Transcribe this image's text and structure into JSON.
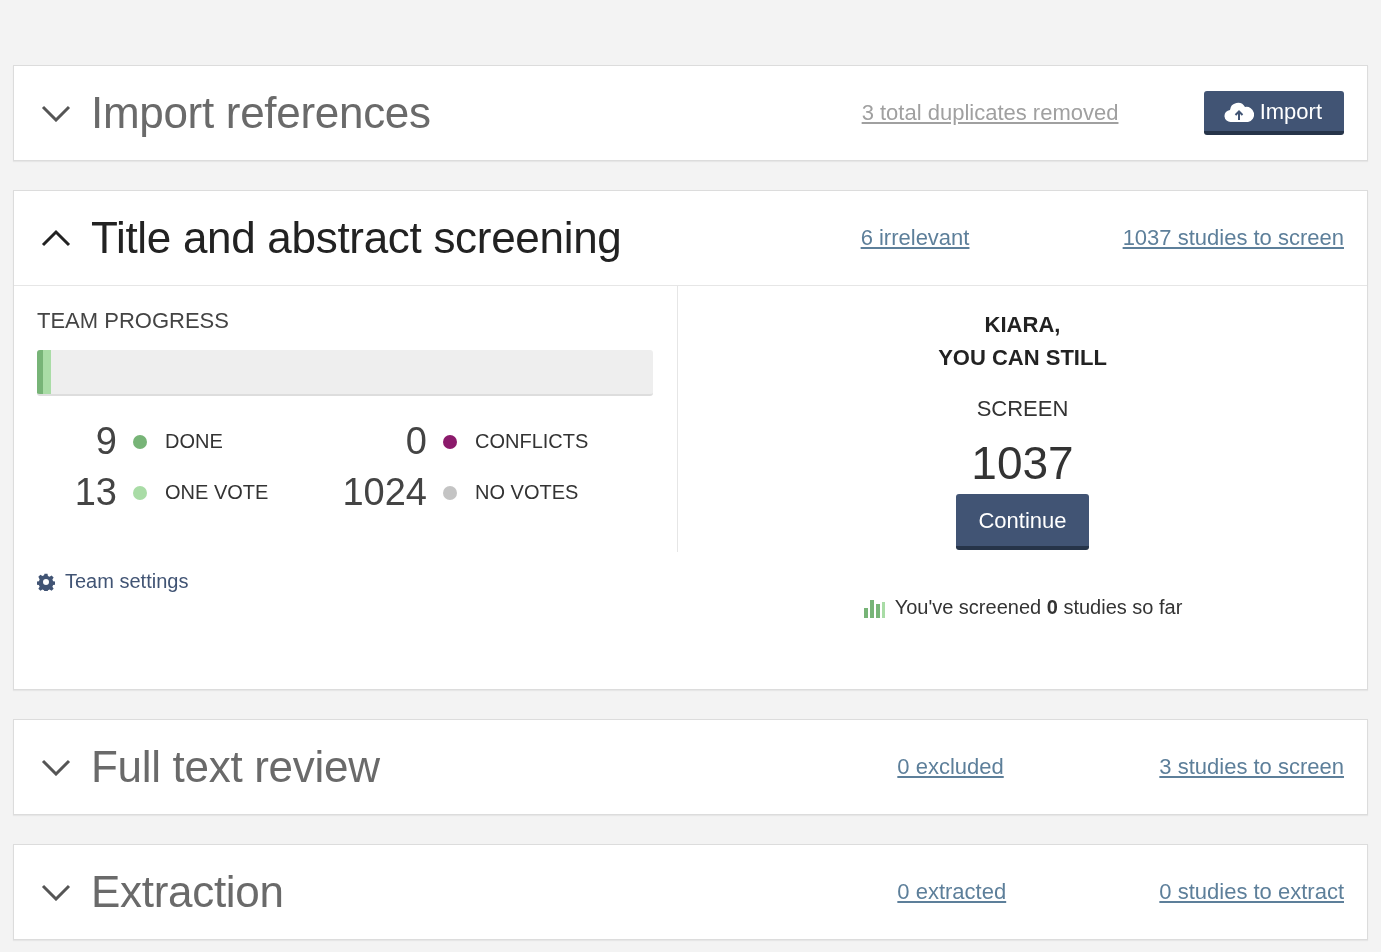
{
  "sections": [
    {
      "title": "Import references",
      "expanded": false,
      "actions": [
        {
          "kind": "muted-link",
          "label": "3 total duplicates removed"
        },
        {
          "kind": "button",
          "label": "Import"
        }
      ]
    },
    {
      "title": "Title and abstract screening",
      "expanded": true,
      "actions": [
        {
          "kind": "link",
          "label": "6 irrelevant"
        },
        {
          "kind": "link",
          "label": "1037 studies to screen"
        }
      ],
      "body": {
        "progress_title": "TEAM PROGRESS",
        "progress_segments": [
          {
            "level": 0.01,
            "color": "#77b477"
          },
          {
            "level": 0.013,
            "color": "#a9dca6"
          }
        ],
        "stats": [
          {
            "count": "9",
            "label": "DONE",
            "color": "#77b477"
          },
          {
            "count": "0",
            "label": "CONFLICTS",
            "color": "#8b1a6b"
          },
          {
            "count": "13",
            "label": "ONE VOTE",
            "color": "#a9dca6"
          },
          {
            "count": "1024",
            "label": "NO VOTES",
            "color": "#c4c4c4"
          }
        ],
        "settings_link": "Team settings",
        "greeting": "KIARA,",
        "greeting_line2": "YOU CAN STILL",
        "screen_label": "SCREEN",
        "remaining": "1037",
        "continue_button": "Continue",
        "screened_note": "You've screened **0** studies so far"
      }
    },
    {
      "title": "Full text review",
      "expanded": false,
      "actions": [
        {
          "kind": "link",
          "label": "0 excluded"
        },
        {
          "kind": "link",
          "label": "3 studies to screen"
        }
      ]
    },
    {
      "title": "Extraction",
      "expanded": false,
      "actions": [
        {
          "kind": "link",
          "label": "0 extracted"
        },
        {
          "kind": "link",
          "label": "0 studies to extract"
        }
      ]
    }
  ]
}
